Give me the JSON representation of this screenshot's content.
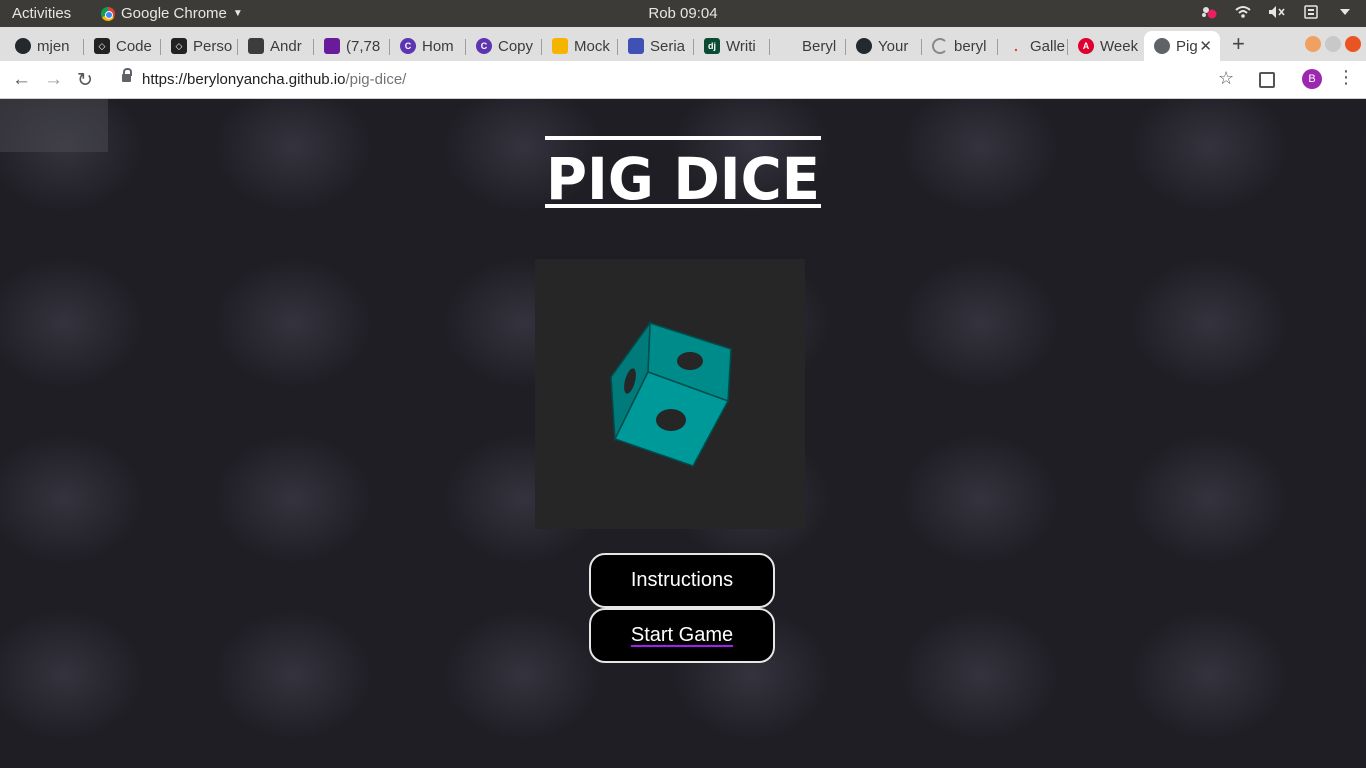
{
  "system_bar": {
    "activities": "Activities",
    "app_name": "Google Chrome",
    "clock": "Rob 09:04"
  },
  "tabs": [
    {
      "label": "mjen",
      "icon": "github-icon",
      "color": "#24292e"
    },
    {
      "label": "Code",
      "icon": "codepen-icon",
      "color": "#222222"
    },
    {
      "label": "Perso",
      "icon": "codepen-icon",
      "color": "#222222"
    },
    {
      "label": "Andr",
      "icon": "android-icon",
      "color": "#3c3c3c"
    },
    {
      "label": "(7,78",
      "icon": "mail-icon",
      "color": "#6a1b9a"
    },
    {
      "label": "Hom",
      "icon": "c-logo-icon",
      "color": "#5e35b1"
    },
    {
      "label": "Copy",
      "icon": "c-logo-icon",
      "color": "#5e35b1"
    },
    {
      "label": "Mock",
      "icon": "slides-icon",
      "color": "#f4b400"
    },
    {
      "label": "Seria",
      "icon": "docs-icon",
      "color": "#3f51b5"
    },
    {
      "label": "Writi",
      "icon": "django-icon",
      "color": "#0c4b33"
    },
    {
      "label": "Beryl",
      "icon": "blank-icon",
      "color": "#cccccc"
    },
    {
      "label": "Your",
      "icon": "github-icon",
      "color": "#24292e"
    },
    {
      "label": "beryl",
      "icon": "loading-icon",
      "color": "#888888"
    },
    {
      "label": "Galle",
      "icon": "dot-icon",
      "color": "#e53935"
    },
    {
      "label": "Week",
      "icon": "angular-icon",
      "color": "#dd0031"
    },
    {
      "label": "Pig",
      "icon": "globe-icon",
      "color": "#5f6368"
    }
  ],
  "omnibox": {
    "url_host": "https://berylonyancha.github.io",
    "url_path": "/pig-dice/"
  },
  "profile": {
    "initial": "B",
    "color": "#9c27b0"
  },
  "page": {
    "logo_text": "PIG DICE",
    "dice_color": "#008b8b",
    "buttons": {
      "instructions": "Instructions",
      "start": "Start Game"
    }
  }
}
